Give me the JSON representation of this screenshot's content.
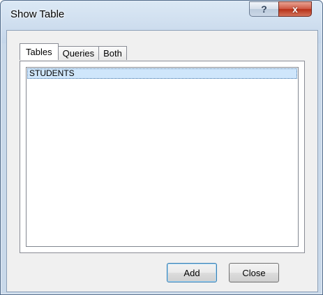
{
  "window": {
    "title": "Show Table",
    "help_glyph": "?",
    "close_glyph": "x"
  },
  "tabs": [
    {
      "label": "Tables",
      "active": true
    },
    {
      "label": "Queries",
      "active": false
    },
    {
      "label": "Both",
      "active": false
    }
  ],
  "list": {
    "items": [
      "STUDENTS"
    ],
    "selected": "STUDENTS"
  },
  "buttons": {
    "add_label": "Add",
    "close_label": "Close"
  },
  "colors": {
    "selection": "#cfe6fb",
    "close_button": "#c7432b"
  }
}
